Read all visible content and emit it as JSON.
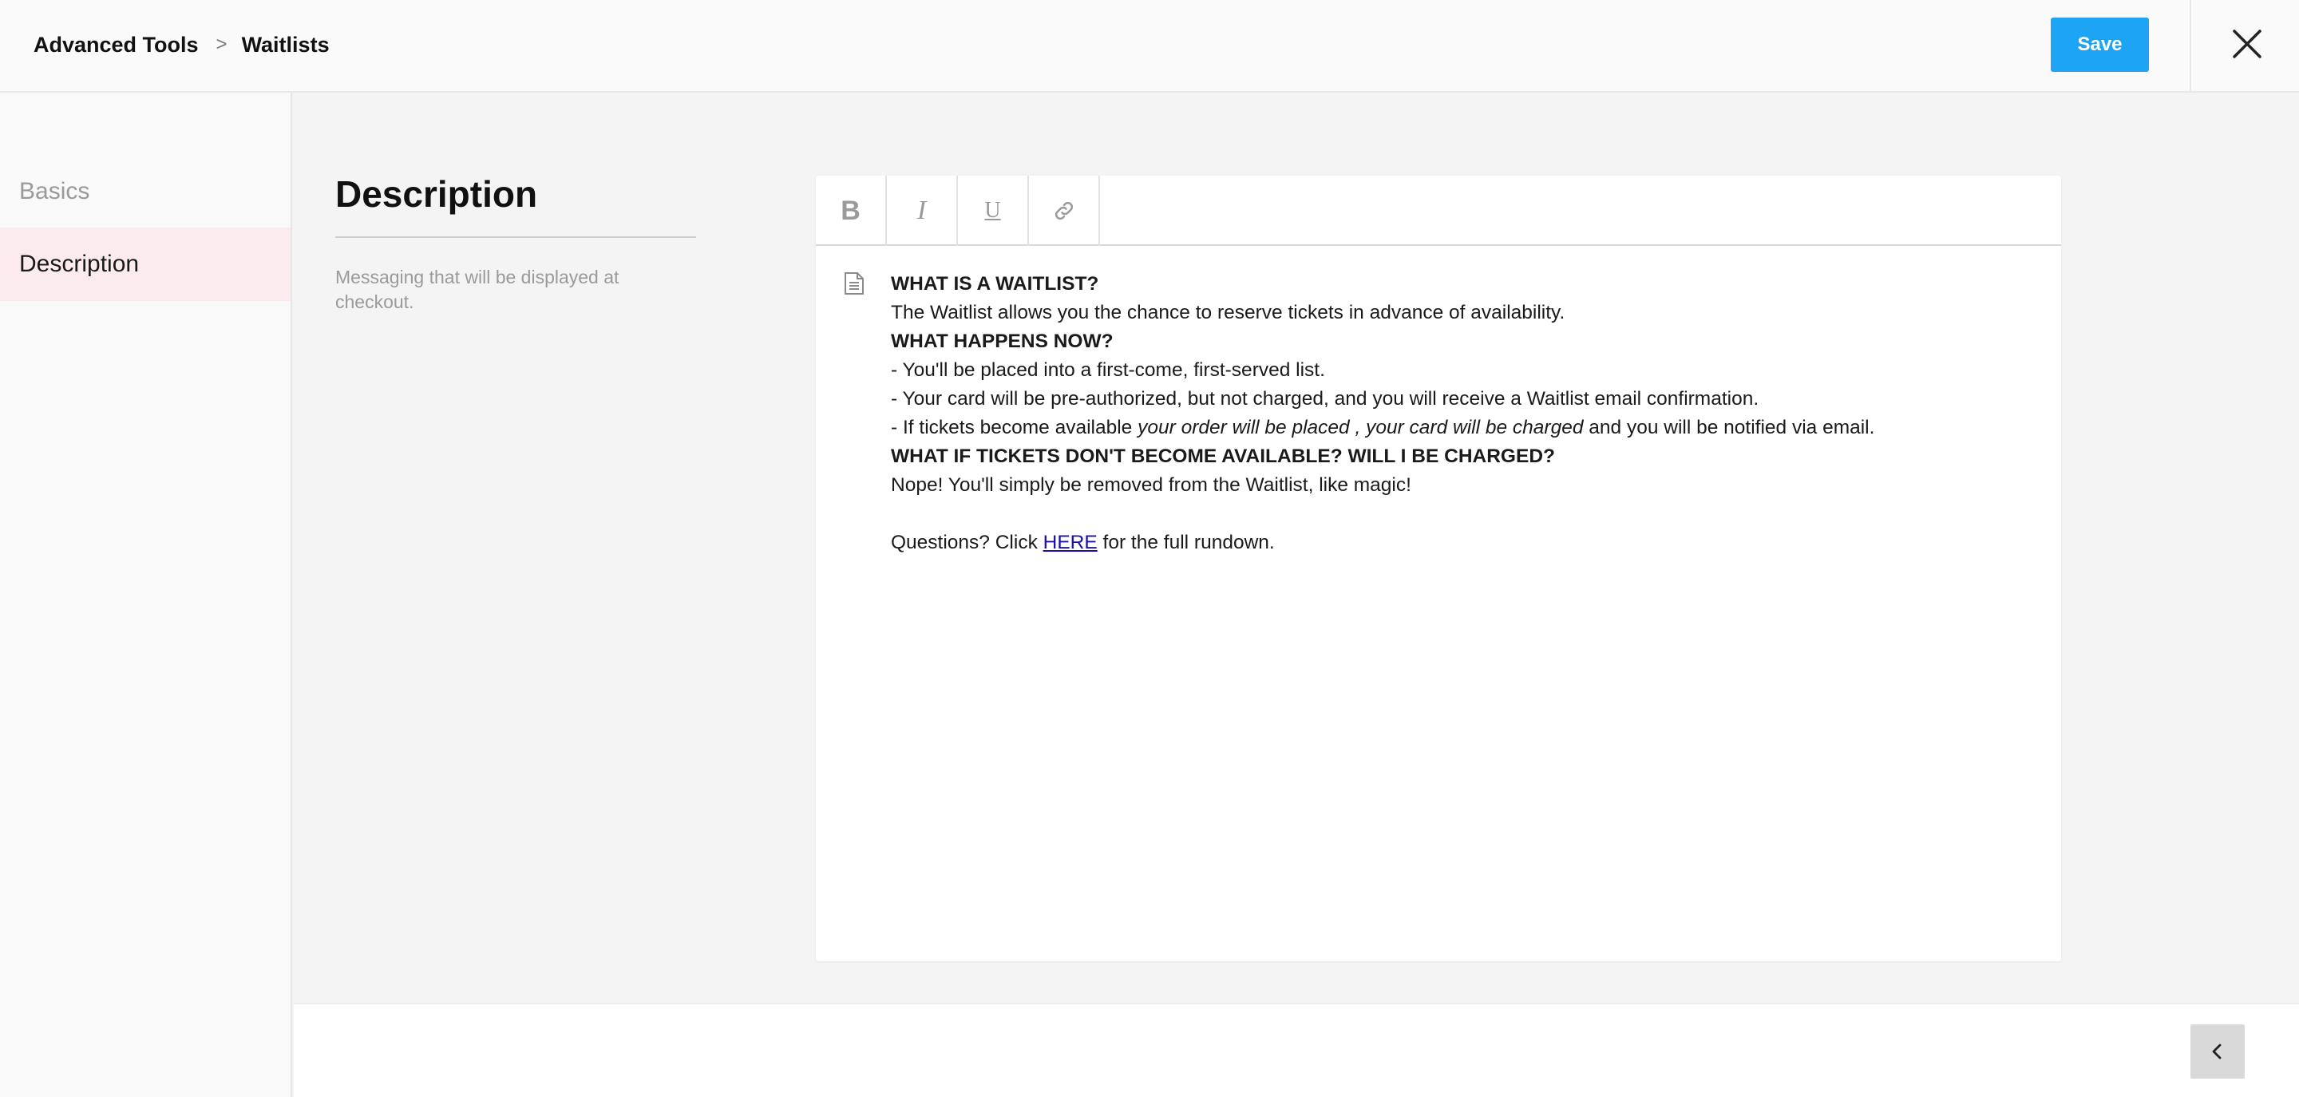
{
  "header": {
    "breadcrumb": {
      "parent": "Advanced Tools",
      "separator": ">",
      "current": "Waitlists"
    },
    "save_label": "Save",
    "close_icon": "close-icon"
  },
  "sidebar": {
    "items": [
      {
        "label": "Basics",
        "active": false
      },
      {
        "label": "Description",
        "active": true
      }
    ]
  },
  "main": {
    "title": "Description",
    "subtitle": "Messaging that will be displayed at checkout."
  },
  "editor": {
    "toolbar": {
      "bold": "B",
      "italic": "I",
      "underline": "U",
      "link_icon": "link-icon"
    },
    "doc_icon": "document-icon",
    "lines": {
      "l1": "WHAT IS A WAITLIST?",
      "l2": "The Waitlist allows you the chance to reserve tickets in advance of availability.",
      "l3": "WHAT HAPPENS NOW?",
      "l4": "- You'll be placed into a first-come, first-served list.",
      "l5": "- Your card will be pre-authorized, but not charged, and you will receive a Waitlist email confirmation.",
      "l6_a": "- If tickets become available ",
      "l6_b": "your order will be placed , your card will be charged",
      "l6_c": " and you will be notified via email.",
      "l7": "WHAT IF TICKETS DON'T BECOME AVAILABLE? WILL I BE CHARGED?",
      "l8": "Nope! You'll simply be removed from the Waitlist, like magic!",
      "l9_a": "Questions? Click ",
      "l9_link": "HERE",
      "l9_c": " for the full rundown."
    }
  },
  "footer": {
    "back_icon": "chevron-left-icon"
  },
  "colors": {
    "accent": "#1ea4f4",
    "active_sidebar_bg": "#fbeaee",
    "link": "#1a0dab"
  }
}
